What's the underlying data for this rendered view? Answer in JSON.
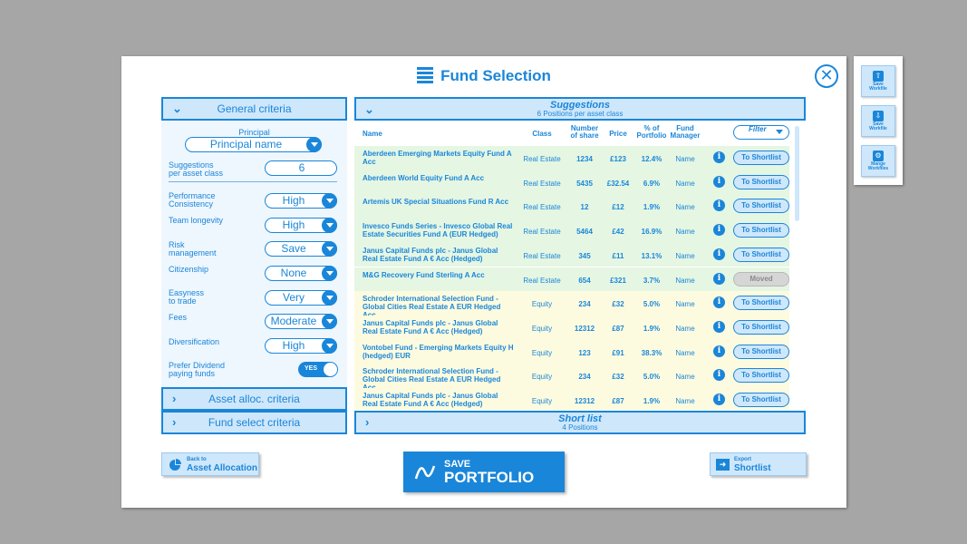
{
  "dialog": {
    "title": "Fund Selection",
    "close_symbol": "✕"
  },
  "left": {
    "general_header": "General criteria",
    "principal": {
      "label": "Principal",
      "value": "Principal name"
    },
    "suggestions": {
      "label1": "Suggestions",
      "label2": "per asset class",
      "value": "6"
    },
    "criteria": [
      {
        "label1": "Performance",
        "label2": "Consistency",
        "value": "High"
      },
      {
        "label1": "Team longevity",
        "label2": "",
        "value": "High"
      },
      {
        "label1": "Risk",
        "label2": "management",
        "value": "Save"
      },
      {
        "label1": "Citizenship",
        "label2": "",
        "value": "None"
      },
      {
        "label1": "Easyness",
        "label2": "to trade",
        "value": "Very"
      },
      {
        "label1": "Fees",
        "label2": "",
        "value": "Moderate"
      },
      {
        "label1": "Diversification",
        "label2": "",
        "value": "High"
      }
    ],
    "dividend": {
      "label1": "Prefer Dividend",
      "label2": "paying funds",
      "toggle": "YES"
    },
    "asset_header": "Asset alloc. criteria",
    "fund_header": "Fund select criteria"
  },
  "suggestions": {
    "title": "Suggestions",
    "subtitle": "6 Positions per asset class",
    "columns": {
      "name": "Name",
      "class": "Class",
      "shares1": "Number",
      "shares2": "of share",
      "price": "Price",
      "pct1": "% of",
      "pct2": "Portfolio",
      "mgr1": "Fund",
      "mgr2": "Manager"
    },
    "filter": "Filter",
    "rows": [
      {
        "name": "Aberdeen Emerging Markets Equity Fund A Acc",
        "class": "Real Estate",
        "shares": "1234",
        "price": "£123",
        "pct": "12.4%",
        "manager": "Name",
        "action": "To Shortlist"
      },
      {
        "name": "Aberdeen World Equity Fund A Acc",
        "class": "Real Estate",
        "shares": "5435",
        "price": "£32.54",
        "pct": "6.9%",
        "manager": "Name",
        "action": "To Shortlist"
      },
      {
        "name": "Artemis UK Special Situations Fund R Acc",
        "class": "Real Estate",
        "shares": "12",
        "price": "£12",
        "pct": "1.9%",
        "manager": "Name",
        "action": "To Shortlist"
      },
      {
        "name": "Invesco Funds Series - Invesco Global Real Estate Securities Fund A (EUR Hedged)",
        "class": "Real Estate",
        "shares": "5464",
        "price": "£42",
        "pct": "16.9%",
        "manager": "Name",
        "action": "To Shortlist"
      },
      {
        "name": "Janus Capital Funds plc - Janus Global Real Estate Fund A € Acc (Hedged)",
        "class": "Real Estate",
        "shares": "345",
        "price": "£11",
        "pct": "13.1%",
        "manager": "Name",
        "action": "To Shortlist"
      },
      {
        "name": " M&G Recovery Fund Sterling A Acc",
        "class": "Real Estate",
        "shares": "654",
        "price": "£321",
        "pct": "3.7%",
        "manager": "Name",
        "action": "Moved"
      },
      {
        "name": "Schroder International Selection Fund - Global Cities Real Estate A EUR Hedged Acc",
        "class": "Equity",
        "shares": "234",
        "price": "£32",
        "pct": "5.0%",
        "manager": "Name",
        "action": "To Shortlist"
      },
      {
        "name": "Janus Capital Funds plc - Janus Global Real Estate Fund A € Acc (Hedged)",
        "class": "Equity",
        "shares": "12312",
        "price": "£87",
        "pct": "1.9%",
        "manager": "Name",
        "action": "To Shortlist"
      },
      {
        "name": "Vontobel Fund - Emerging Markets Equity H (hedged) EUR",
        "class": "Equity",
        "shares": "123",
        "price": "£91",
        "pct": "38.3%",
        "manager": "Name",
        "action": "To Shortlist"
      },
      {
        "name": "Schroder International Selection Fund - Global Cities Real Estate A EUR Hedged Acc",
        "class": "Equity",
        "shares": "234",
        "price": "£32",
        "pct": "5.0%",
        "manager": "Name",
        "action": "To Shortlist"
      },
      {
        "name": "Janus Capital Funds plc - Janus Global Real Estate Fund A € Acc (Hedged)",
        "class": "Equity",
        "shares": "12312",
        "price": "£87",
        "pct": "1.9%",
        "manager": "Name",
        "action": "To Shortlist"
      }
    ]
  },
  "shortlist": {
    "title": "Short list",
    "subtitle": "4 Positions"
  },
  "buttons": {
    "back": {
      "small": "Back to",
      "big": "Asset Allocation"
    },
    "save": {
      "small": "SAVE",
      "big": "PORTFOLIO"
    },
    "export": {
      "small": "Export",
      "big": "Shortlist"
    }
  },
  "sidebar": [
    {
      "label": "Save Workfile",
      "icon": "upload-icon"
    },
    {
      "label": "Save Workfile",
      "icon": "download-icon"
    },
    {
      "label": "Mange Workfiles",
      "icon": "gear-icon"
    }
  ]
}
